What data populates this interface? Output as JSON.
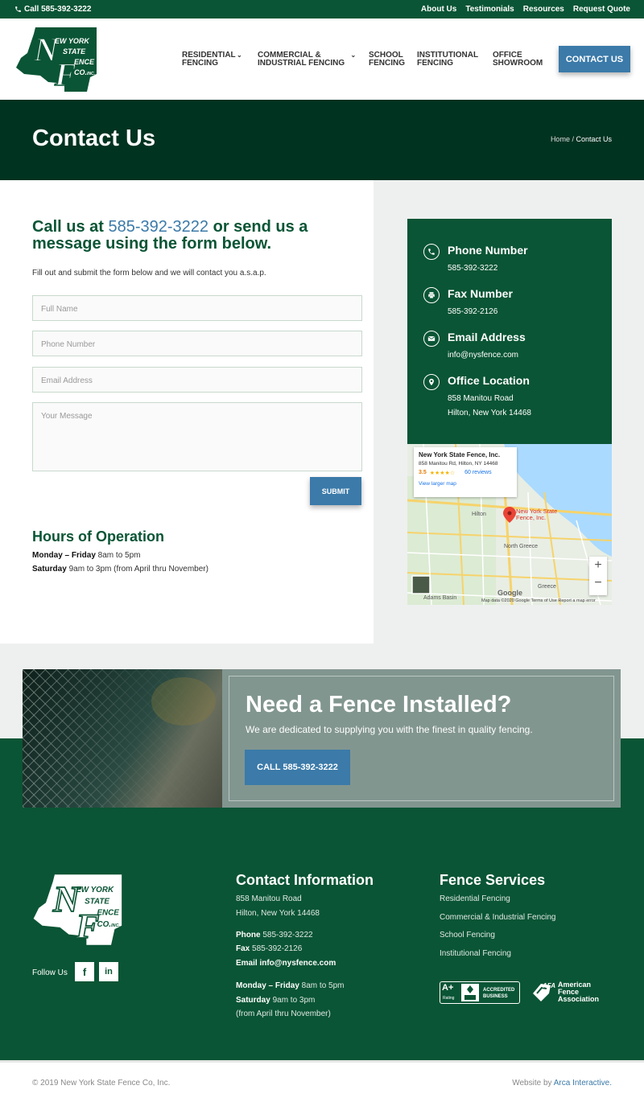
{
  "topbar": {
    "call_label": "Call 585-392-3222",
    "links": [
      "About Us",
      "Testimonials",
      "Resources",
      "Request Quote"
    ]
  },
  "logo": {
    "line1": "EW YORK",
    "line2": "STATE",
    "line3": "ENCE",
    "line4": "CO.",
    "inc": "INC."
  },
  "nav": {
    "items": [
      {
        "line1": "RESIDENTIAL",
        "line2": "FENCING",
        "has_dropdown": true
      },
      {
        "line1": "COMMERCIAL &",
        "line2": "INDUSTRIAL FENCING",
        "has_dropdown": true
      },
      {
        "line1": "SCHOOL",
        "line2": "FENCING",
        "has_dropdown": false
      },
      {
        "line1": "INSTITUTIONAL",
        "line2": "FENCING",
        "has_dropdown": false
      },
      {
        "line1": "OFFICE",
        "line2": "SHOWROOM",
        "has_dropdown": false
      }
    ],
    "contact_button": "CONTACT US"
  },
  "title_band": {
    "title": "Contact Us",
    "breadcrumb_home": "Home",
    "breadcrumb_sep": " / ",
    "breadcrumb_current": "Contact Us"
  },
  "form": {
    "heading_prefix": "Call us at ",
    "heading_phone": "585-392-3222",
    "heading_suffix": " or send us a message using the form below.",
    "intro": "Fill out and submit the form below and we will contact you a.s.a.p.",
    "full_name_placeholder": "Full Name",
    "phone_placeholder": "Phone Number",
    "email_placeholder": "Email Address",
    "message_placeholder": "Your Message",
    "submit_label": "SUBMIT"
  },
  "hours": {
    "title": "Hours of Operation",
    "weekday_label": "Monday – Friday",
    "weekday_hours": " 8am to 5pm",
    "saturday_label": "Saturday",
    "saturday_hours": " 9am to 3pm (from April thru November)"
  },
  "info_card": {
    "phone_label": "Phone Number",
    "phone_value": "585-392-3222",
    "fax_label": "Fax Number",
    "fax_value": "585-392-2126",
    "email_label": "Email Address",
    "email_value": "info@nysfence.com",
    "office_label": "Office Location",
    "office_line1": "858 Manitou Road",
    "office_line2": "Hilton, New York 14468"
  },
  "map": {
    "popup_title": "New York State Fence, Inc.",
    "popup_address": "858 Manitou Rd, Hilton, NY 14468",
    "rating": "3.5",
    "stars": "★★★★☆",
    "reviews": "60 reviews",
    "view_larger": "View larger map",
    "pin_label_1": "New York State",
    "pin_label_2": "Fence, Inc.",
    "town_hilton": "Hilton",
    "town_north_greece": "North Greece",
    "town_greece": "Greece",
    "town_adams_basin": "Adams Basin",
    "google": "Google",
    "footer_text": "Map data ©2020 Google   Terms of Use   Report a map error",
    "zoom_in": "+",
    "zoom_out": "−"
  },
  "cta": {
    "title": "Need a Fence Installed?",
    "subtitle": "We are dedicated to supplying you with the finest in quality fencing.",
    "button": "CALL 585-392-3222"
  },
  "footer": {
    "follow_label": "Follow Us",
    "facebook": "f",
    "linkedin": "in",
    "contact_title": "Contact Information",
    "address_line1": "858 Manitou Road",
    "address_line2": "Hilton, New York 14468",
    "phone_label": "Phone",
    "phone_value": " 585-392-3222",
    "fax_label": "Fax",
    "fax_value": " 585-392-2126",
    "email_label": "Email",
    "email_value": " info@nysfence.com",
    "weekday_label": "Monday – Friday",
    "weekday_hours": " 8am to 5pm",
    "saturday_label": "Saturday",
    "saturday_hours": " 9am to 3pm",
    "season_note": "(from April thru November)",
    "services_title": "Fence Services",
    "services": [
      "Residential Fencing",
      "Commercial & Industrial Fencing",
      "School Fencing",
      "Institutional Fencing"
    ],
    "bbb_grade": "A+",
    "bbb_rating": "Rating",
    "bbb_accredited": "ACCREDITED",
    "bbb_business": "BUSINESS",
    "afa_line1": "American",
    "afa_line2": "Fence",
    "afa_line3": "Association",
    "afa_mark": "AFA"
  },
  "bottom": {
    "copyright": "© 2019 New York State Fence Co, Inc.",
    "credit_prefix": "Website by ",
    "credit_link": "Arca Interactive."
  },
  "colors": {
    "brand_green": "#0a5535",
    "dark_green": "#013321",
    "accent_blue": "#3b7aa9",
    "cta_gray_green": "#829690"
  }
}
